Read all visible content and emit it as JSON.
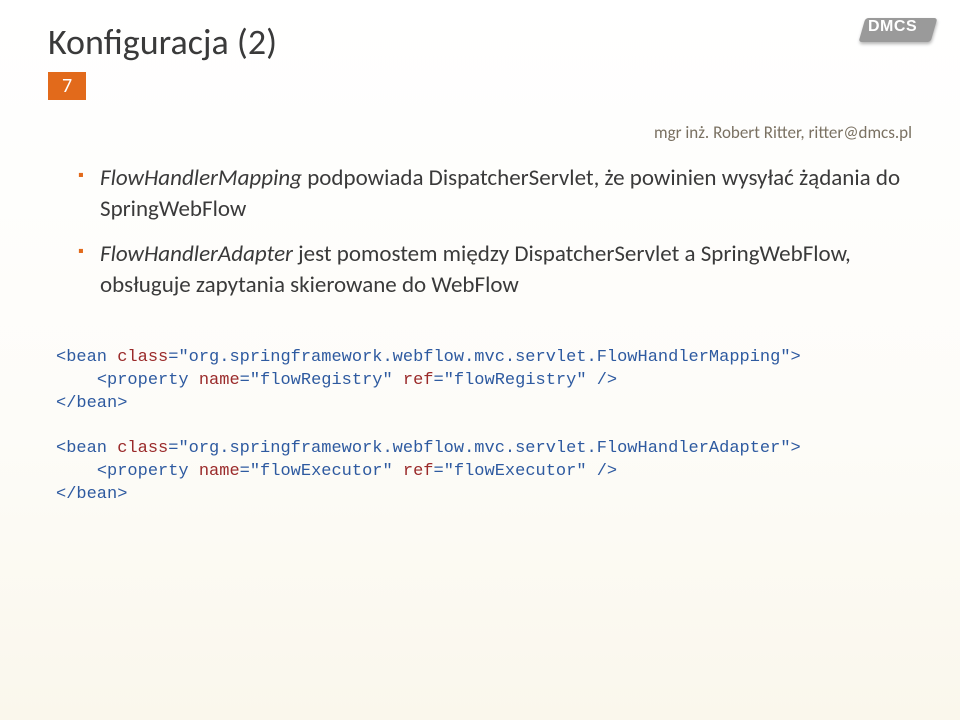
{
  "title": "Konfiguracja (2)",
  "page_number": "7",
  "footer": "mgr inż. Robert Ritter, ritter@dmcs.pl",
  "logo_text": "DMCS",
  "bullets": [
    {
      "prefix_em": "FlowHandlerMapping",
      "rest": " podpowiada DispatcherServlet, że powinien wysyłać żądania do SpringWebFlow"
    },
    {
      "prefix_em": "FlowHandlerAdapter",
      "rest": " jest pomostem między DispatcherServlet a SpringWebFlow, obsługuje zapytania skierowane do WebFlow"
    }
  ],
  "code": {
    "bean1_open_tag": "<bean ",
    "bean1_class_attr": "class",
    "bean1_class_eq": "=",
    "bean1_class_val": "\"org.springframework.webflow.mvc.servlet.FlowHandlerMapping\"",
    "bean1_open_close": ">",
    "bean1_prop_indent": "    ",
    "bean1_prop_tag": "<property ",
    "bean1_prop_name_attr": "name",
    "bean1_prop_name_val": "\"flowRegistry\"",
    "bean1_prop_ref_attr": "ref",
    "bean1_prop_ref_val": "\"flowRegistry\"",
    "bean1_prop_close": " />",
    "bean_close": "</bean>",
    "bean2_open_tag": "<bean ",
    "bean2_class_attr": "class",
    "bean2_class_eq": "=",
    "bean2_class_val": "\"org.springframework.webflow.mvc.servlet.FlowHandlerAdapter\"",
    "bean2_open_close": ">",
    "bean2_prop_indent": "    ",
    "bean2_prop_tag": "<property ",
    "bean2_prop_name_attr": "name",
    "bean2_prop_name_val": "\"flowExecutor\"",
    "bean2_prop_ref_attr": "ref",
    "bean2_prop_ref_val": "\"flowExecutor\"",
    "bean2_prop_close": " />"
  }
}
